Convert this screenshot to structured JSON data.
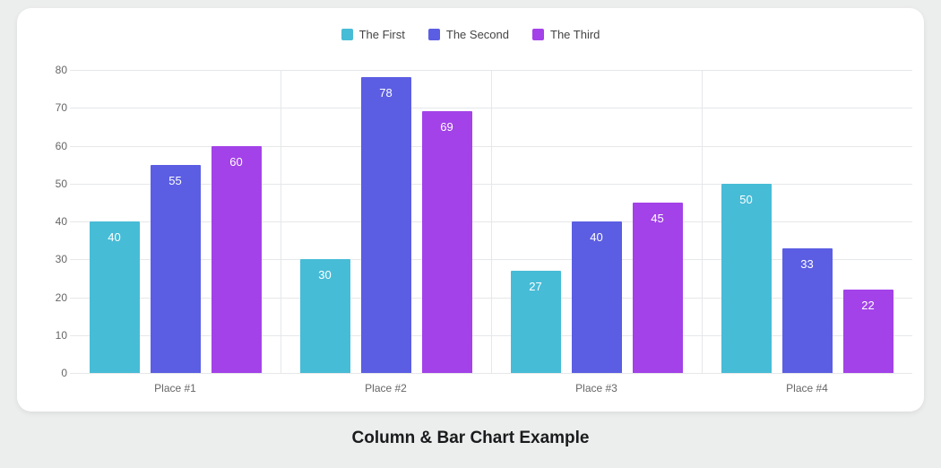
{
  "chart_data": {
    "type": "bar",
    "title": "Column & Bar Chart Example",
    "xlabel": "",
    "ylabel": "",
    "categories": [
      "Place #1",
      "Place #2",
      "Place #3",
      "Place #4"
    ],
    "series": [
      {
        "name": "The First",
        "color": "#47bcd6",
        "values": [
          40,
          30,
          27,
          50
        ]
      },
      {
        "name": "The Second",
        "color": "#5b5ee2",
        "values": [
          55,
          78,
          40,
          33
        ]
      },
      {
        "name": "The Third",
        "color": "#a342e8",
        "values": [
          60,
          69,
          45,
          22
        ]
      }
    ],
    "ylim": [
      0,
      80
    ],
    "yticks": [
      0,
      10,
      20,
      30,
      40,
      50,
      60,
      70,
      80
    ]
  }
}
